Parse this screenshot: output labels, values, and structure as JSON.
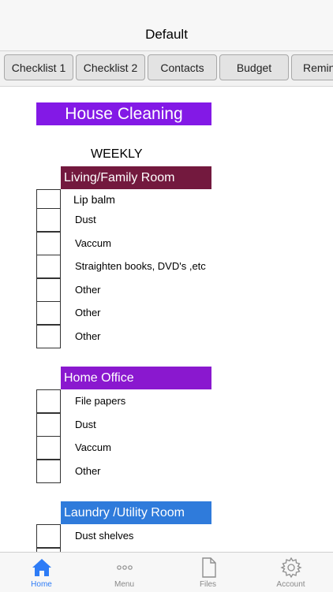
{
  "nav": {
    "title": "Default"
  },
  "tabs": [
    {
      "label": "Checklist 1"
    },
    {
      "label": "Checklist 2"
    },
    {
      "label": "Contacts"
    },
    {
      "label": "Budget"
    },
    {
      "label": "Reminders"
    }
  ],
  "page": {
    "title": "House Cleaning",
    "frequency": "WEEKLY"
  },
  "sections": [
    {
      "header": "Living/Family Room",
      "color": "#73193e",
      "items": [
        "Lip balm",
        "Dust",
        "Vaccum",
        "Straighten books, DVD's ,etc",
        "Other",
        "Other",
        "Other"
      ]
    },
    {
      "header": "Home Office",
      "color": "#8a18cf",
      "items": [
        "File papers",
        "Dust",
        "Vaccum",
        "Other"
      ]
    },
    {
      "header": "Laundry /Utility Room",
      "color": "#2f7bdb",
      "items": [
        "Dust shelves",
        ""
      ]
    }
  ],
  "bottom_tabs": [
    {
      "label": "Home",
      "icon": "home-icon",
      "active": true
    },
    {
      "label": "Menu",
      "icon": "more-dots-icon",
      "active": false
    },
    {
      "label": "Files",
      "icon": "document-icon",
      "active": false
    },
    {
      "label": "Account",
      "icon": "gear-icon",
      "active": false
    }
  ],
  "colors": {
    "accent": "#2e7cf6",
    "title_bg": "#8319e6"
  }
}
